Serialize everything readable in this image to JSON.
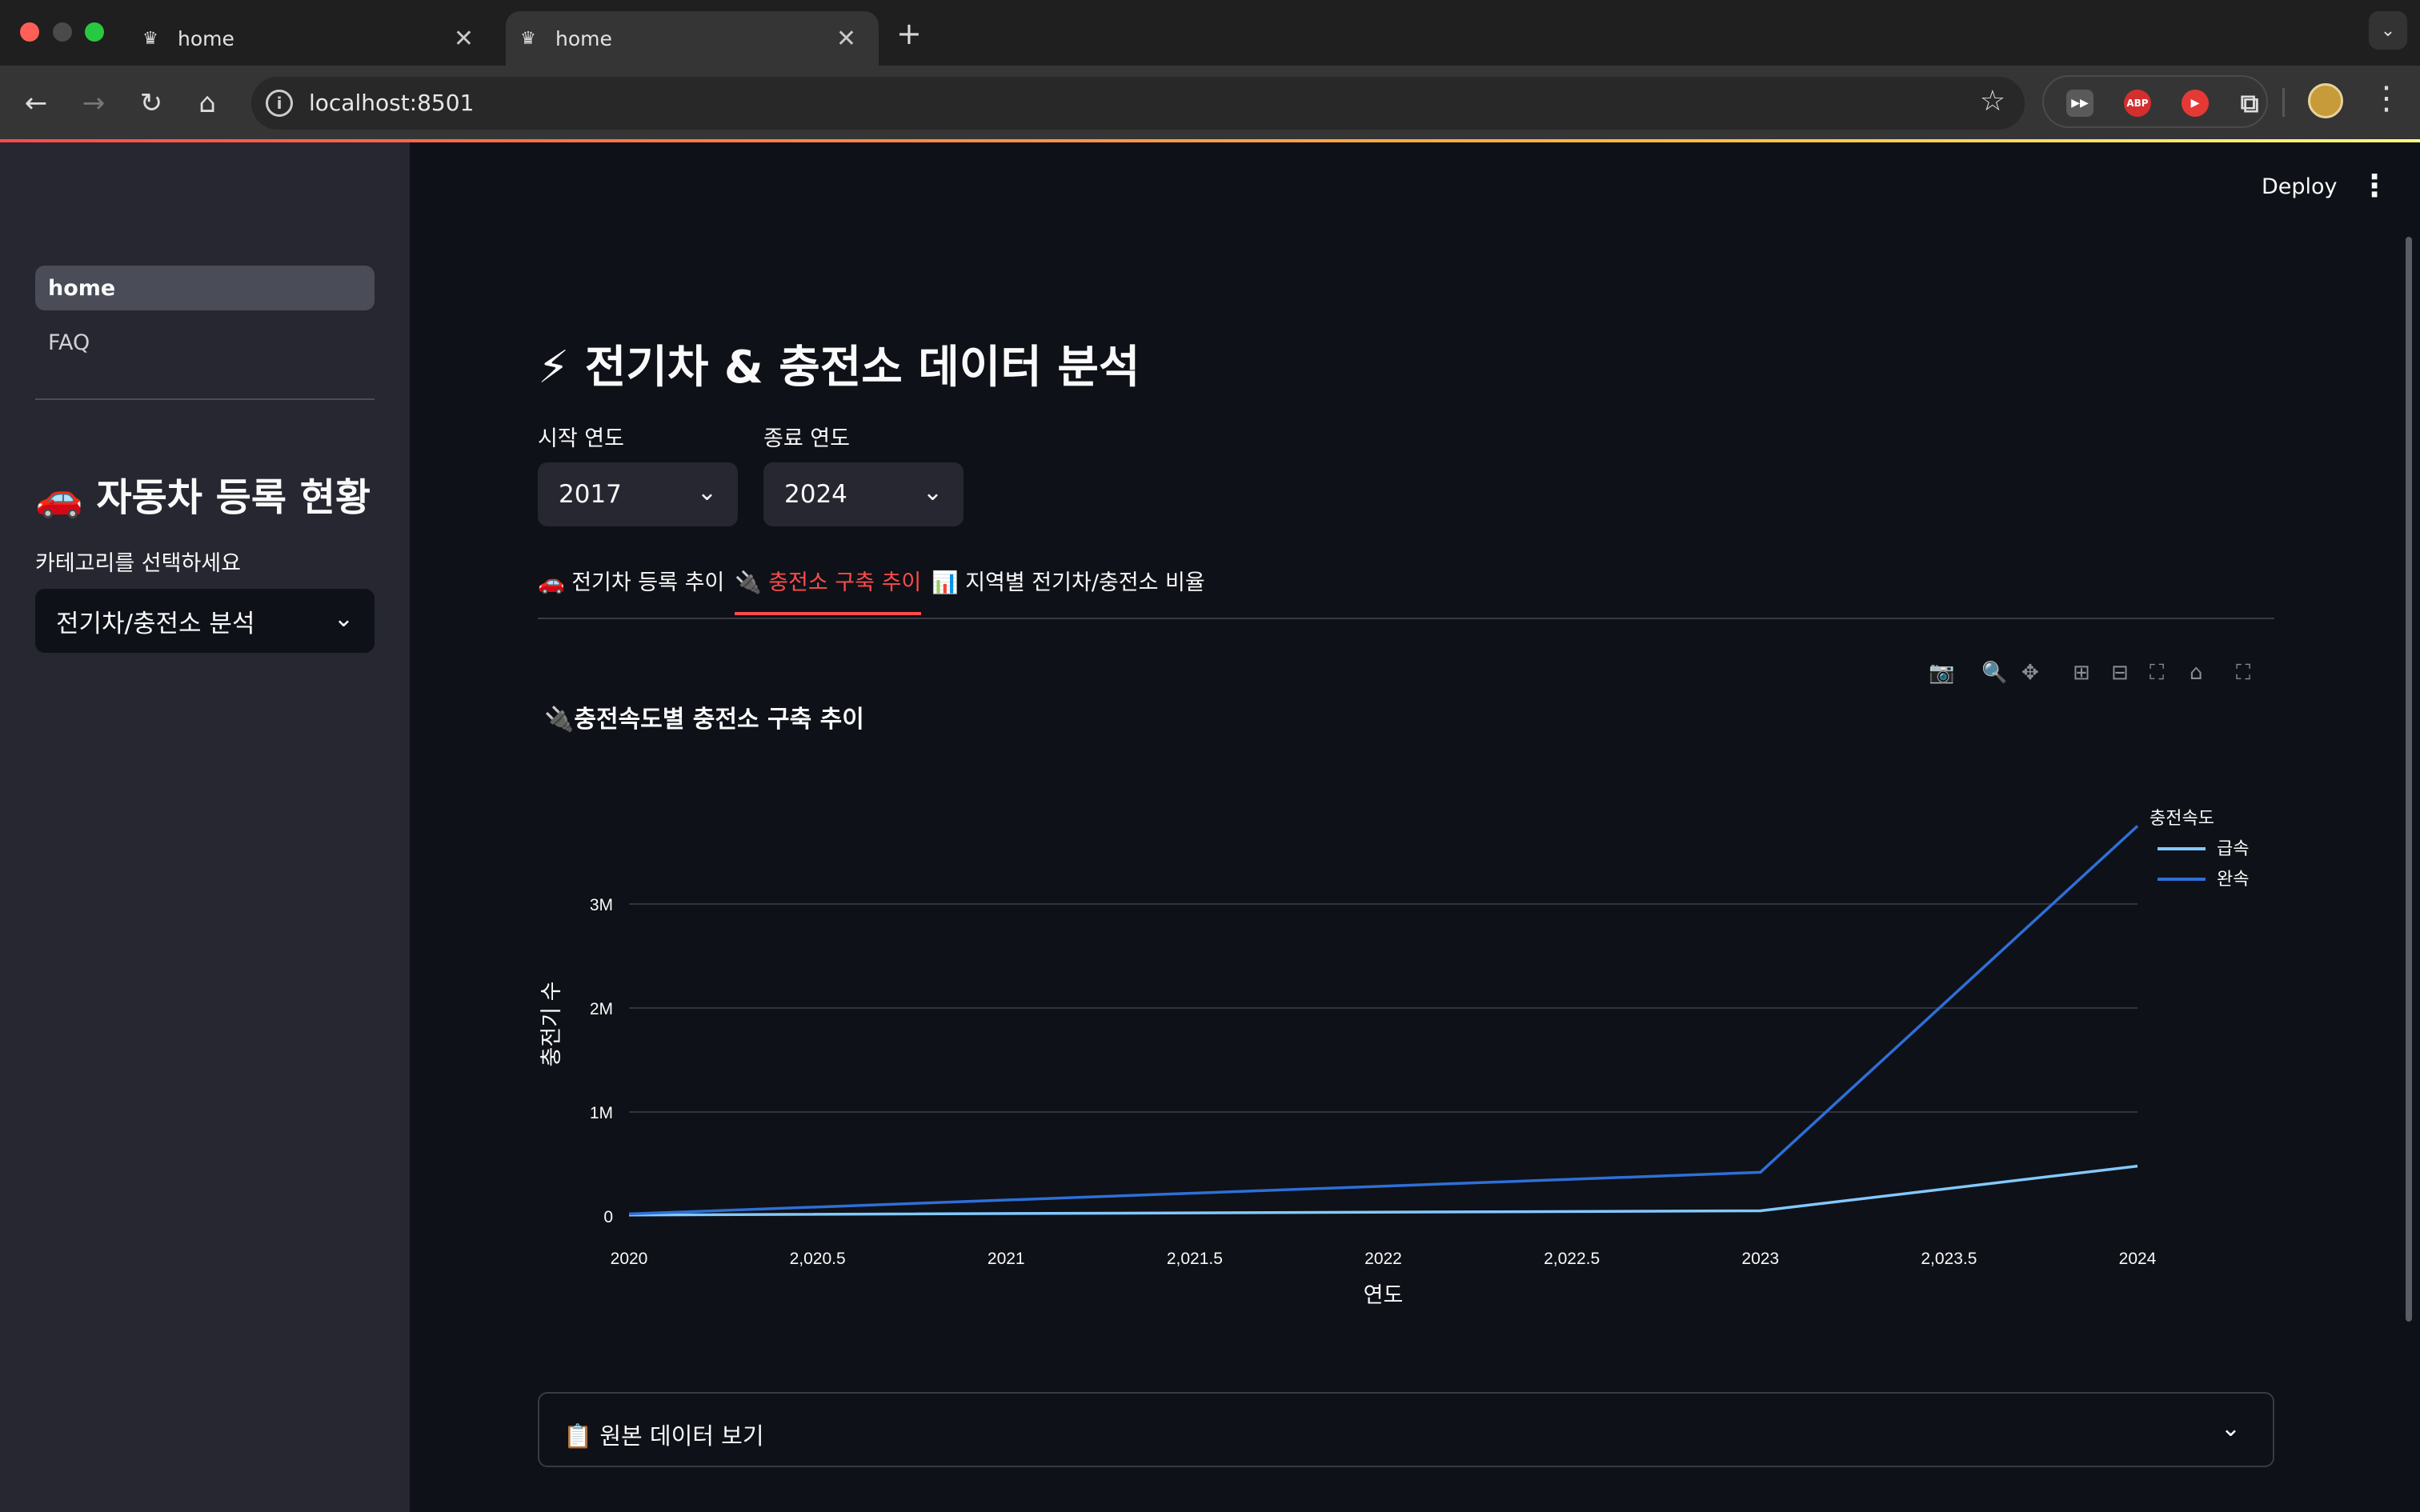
{
  "browser": {
    "tabs": [
      {
        "title": "home",
        "active": false
      },
      {
        "title": "home",
        "active": true
      }
    ],
    "url": "localhost:8501",
    "extensions": {
      "abp_label": "ABP"
    }
  },
  "app": {
    "deploy_label": "Deploy",
    "sidebar": {
      "nav": [
        {
          "label": "home",
          "active": true
        },
        {
          "label": "FAQ",
          "active": false
        }
      ],
      "heading": "🚗 자동차 등록 현황",
      "category_label": "카테고리를 선택하세요",
      "category_value": "전기차/충전소 분석"
    },
    "main": {
      "title": "⚡ 전기차 & 충전소 데이터 분석",
      "start_year": {
        "label": "시작 연도",
        "value": "2017"
      },
      "end_year": {
        "label": "종료 연도",
        "value": "2024"
      },
      "tabs": [
        {
          "label": "🚗 전기차 등록 추이",
          "active": false
        },
        {
          "label": "🔌 충전소 구축 추이",
          "active": true
        },
        {
          "label": "📊 지역별 전기차/충전소 비율",
          "active": false
        }
      ],
      "chart_title": "🔌충전속도별 충전소 구축 추이",
      "expander_label": "📋 원본 데이터 보기"
    }
  },
  "colors": {
    "accent": "#ff4b4b",
    "series_fast": "#83c9ff",
    "series_slow": "#0068c9"
  },
  "chart_data": {
    "type": "line",
    "title": "🔌충전속도별 충전소 구축 추이",
    "xlabel": "연도",
    "ylabel": "충전기 수",
    "xlim": [
      2020,
      2024
    ],
    "ylim": [
      0,
      4000000
    ],
    "x_ticks": [
      "2020",
      "2,020.5",
      "2021",
      "2,021.5",
      "2022",
      "2,022.5",
      "2023",
      "2,023.5",
      "2024"
    ],
    "y_ticks": [
      {
        "value": 0,
        "label": "0"
      },
      {
        "value": 1000000,
        "label": "1M"
      },
      {
        "value": 2000000,
        "label": "2M"
      },
      {
        "value": 3000000,
        "label": "3M"
      }
    ],
    "legend_title": "충전속도",
    "legend_position": "top-right",
    "grid": true,
    "series": [
      {
        "name": "급속",
        "color": "#83c9ff",
        "x": [
          2020,
          2023,
          2024
        ],
        "y": [
          10000,
          50000,
          480000
        ]
      },
      {
        "name": "완속",
        "color": "#2e6fd8",
        "x": [
          2020,
          2023,
          2024
        ],
        "y": [
          20000,
          420000,
          3750000
        ]
      }
    ]
  }
}
